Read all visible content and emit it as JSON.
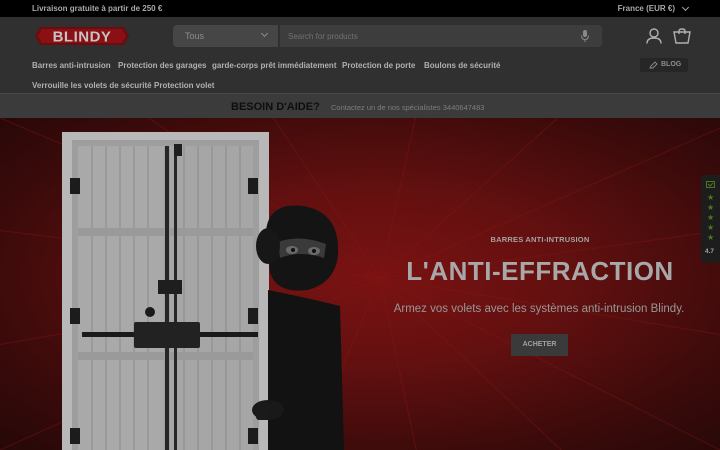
{
  "topbar": {
    "promo": "Livraison gratuite à partir de 250 €",
    "locale": "France (EUR €)"
  },
  "header": {
    "logo_text": "BLINDY",
    "category_select": "Tous",
    "search_placeholder": "Search for products"
  },
  "nav": {
    "items": [
      "Barres anti-intrusion",
      "Protection des garages",
      "garde-corps prêt immédiatement",
      "Protection de porte",
      "Boulons de sécurité",
      "Verrouille les volets de sécurité",
      "Protection volet"
    ],
    "blog": "BLOG"
  },
  "help": {
    "title": "BESOIN D'AIDE?",
    "text": "Contactez un de nos spécialistes 3440647483"
  },
  "hero": {
    "eyebrow": "BARRES ANTI-INTRUSION",
    "headline": "L'ANTI-EFFRACTION",
    "subtitle": "Armez vos volets avec les systèmes anti-intrusion Blindy.",
    "cta": "ACHETER"
  },
  "reviews_widget": {
    "score": "4.7",
    "stars": 5
  },
  "icons": [
    "chevron-down-icon",
    "microphone-icon",
    "account-icon",
    "cart-icon",
    "blog-pen-icon",
    "star-icon"
  ],
  "colors": {
    "brand_red": "#c0181e",
    "hero_red": "#641010",
    "review_green": "#4b7a1e"
  }
}
